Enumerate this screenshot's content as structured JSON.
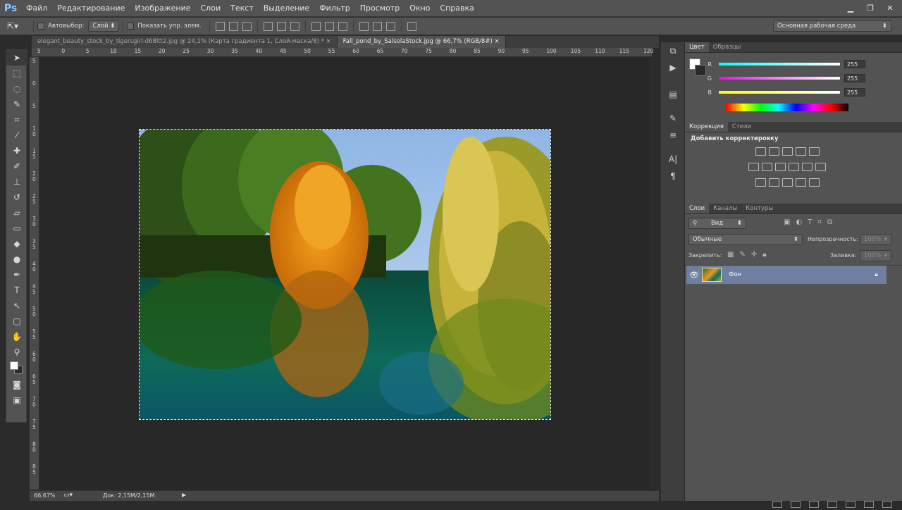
{
  "app": {
    "logo": "Ps"
  },
  "menu": [
    "Файл",
    "Редактирование",
    "Изображение",
    "Слои",
    "Текст",
    "Выделение",
    "Фильтр",
    "Просмотр",
    "Окно",
    "Справка"
  ],
  "window_controls": {
    "minimize": "▁",
    "restore": "❐",
    "close": "✕"
  },
  "options": {
    "autoselect_label": "Автовыбор:",
    "autoselect_value": "Слой",
    "show_controls_label": "Показать упр. элем.",
    "workspace": "Основная рабочая среда"
  },
  "tabs": [
    {
      "label": "elegant_beauty_stock_by_tigersgirl-d68ltt2.jpg @ 24,1% (Карта градиента 1, Слой-маска/8) *",
      "close": "×"
    },
    {
      "label": "Fall_pond_by_SalsolaStock.jpg @ 66,7% (RGB/8#)",
      "close": "×"
    }
  ],
  "ruler_h": [
    "5",
    "0",
    "5",
    "10",
    "15",
    "20",
    "25",
    "30",
    "35",
    "40",
    "45",
    "50",
    "55",
    "60",
    "65",
    "70",
    "75",
    "80",
    "85",
    "90",
    "95",
    "100",
    "105",
    "110",
    "115",
    "120"
  ],
  "ruler_v": [
    "5",
    "0",
    "5",
    "1\n0",
    "1\n5",
    "2\n0",
    "2\n5",
    "3\n0",
    "3\n5",
    "4\n0",
    "4\n5",
    "5\n0",
    "5\n5",
    "6\n0",
    "6\n5",
    "7\n0",
    "7\n5",
    "8\n0",
    "8\n5"
  ],
  "status": {
    "zoom": "66,67%",
    "doc": "Док: 2,15M/2,15M"
  },
  "color_panel": {
    "tabs": [
      "Цвет",
      "Образцы"
    ],
    "channels": [
      {
        "label": "R",
        "value": "255"
      },
      {
        "label": "G",
        "value": "255"
      },
      {
        "label": "B",
        "value": "255"
      }
    ]
  },
  "adjust_panel": {
    "tabs": [
      "Коррекция",
      "Стили"
    ],
    "heading": "Добавить корректировку"
  },
  "layers_panel": {
    "tabs": [
      "Слои",
      "Каналы",
      "Контуры"
    ],
    "filter_label": "Вид",
    "blend_mode": "Обычные",
    "opacity_label": "Непрозрачность:",
    "opacity_value": "100%",
    "lock_label": "Закрепить:",
    "fill_label": "Заливка:",
    "fill_value": "100%",
    "layers": [
      {
        "name": "Фон"
      }
    ]
  }
}
